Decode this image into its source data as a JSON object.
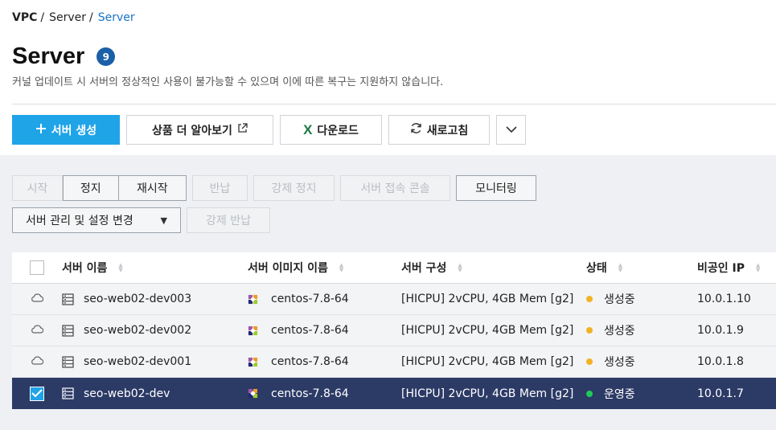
{
  "breadcrumb": [
    "VPC",
    "Server",
    "Server"
  ],
  "page": {
    "title": "Server",
    "count": "9",
    "subtitle": "커널 업데이트 시 서버의 정상적인 사용이 불가능할 수 있으며 이에 따른 복구는 지원하지 않습니다."
  },
  "toolbar": {
    "create_label": "서버 생성",
    "learn_label": "상품 더 알아보기",
    "download_label": "다운로드",
    "refresh_label": "새로고침"
  },
  "actions": {
    "start": "시작",
    "stop": "정지",
    "restart": "재시작",
    "return": "반납",
    "force_stop": "강제 정지",
    "console": "서버 접속 콘솔",
    "monitoring": "모니터링",
    "manage": "서버 관리 및 설정 변경",
    "force_return": "강제 반납"
  },
  "table": {
    "headers": {
      "name": "서버 이름",
      "image": "서버 이미지 이름",
      "spec": "서버 구성",
      "status": "상태",
      "ip": "비공인 IP"
    },
    "rows": [
      {
        "name": "seo-web02-dev003",
        "image": "centos-7.8-64",
        "spec": "[HICPU] 2vCPU, 4GB Mem [g2]",
        "status": "생성중",
        "ip": "10.0.1.10",
        "status_color": "#f0b323",
        "selected": false
      },
      {
        "name": "seo-web02-dev002",
        "image": "centos-7.8-64",
        "spec": "[HICPU] 2vCPU, 4GB Mem [g2]",
        "status": "생성중",
        "ip": "10.0.1.9",
        "status_color": "#f0b323",
        "selected": false
      },
      {
        "name": "seo-web02-dev001",
        "image": "centos-7.8-64",
        "spec": "[HICPU] 2vCPU, 4GB Mem [g2]",
        "status": "생성중",
        "ip": "10.0.1.8",
        "status_color": "#f0b323",
        "selected": false
      },
      {
        "name": "seo-web02-dev",
        "image": "centos-7.8-64",
        "spec": "[HICPU] 2vCPU, 4GB Mem [g2]",
        "status": "운영중",
        "ip": "10.0.1.7",
        "status_color": "#21c95b",
        "selected": true
      }
    ]
  },
  "colors": {
    "primary": "#20a4e8",
    "selected_row": "#2c3a66",
    "badge": "#1b5fa8",
    "status_creating": "#f0b323",
    "status_running": "#21c95b"
  }
}
